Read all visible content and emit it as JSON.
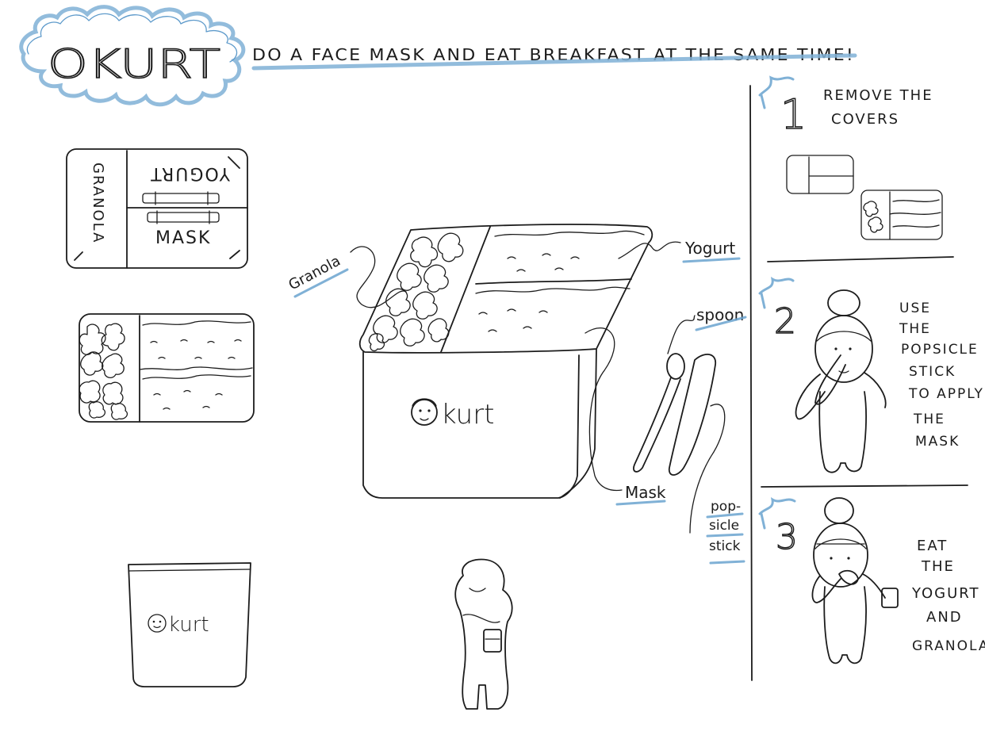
{
  "header": {
    "brand": "OKURT",
    "tagline": "DO A FACE MASK AND EAT BREAKFAST AT THE SAME TIME!"
  },
  "topview": {
    "left_label": "GRANOLA",
    "top_label": "YOGURT",
    "bottom_label": "MASK"
  },
  "callouts": {
    "granola": "Granola",
    "yogurt": "Yogurt",
    "spoon": "spoon",
    "mask": "Mask",
    "popsicle_1": "pop-",
    "popsicle_2": "sicle",
    "popsicle_3": "stick"
  },
  "box_logo": "kurt",
  "cup_logo": "kurt",
  "steps": [
    {
      "number": "1",
      "line1": "REMOVE THE",
      "line2": "COVERS"
    },
    {
      "number": "2",
      "lines": [
        "USE",
        "THE",
        "POPSICLE",
        "STICK",
        "TO APPLY",
        "THE",
        "MASK"
      ]
    },
    {
      "number": "3",
      "lines": [
        "EAT",
        "THE",
        "YOGURT",
        "AND",
        "GRANOLA"
      ]
    }
  ],
  "colors": {
    "ink": "#1c1c1c",
    "highlight_blue": "#7fb0d6"
  }
}
